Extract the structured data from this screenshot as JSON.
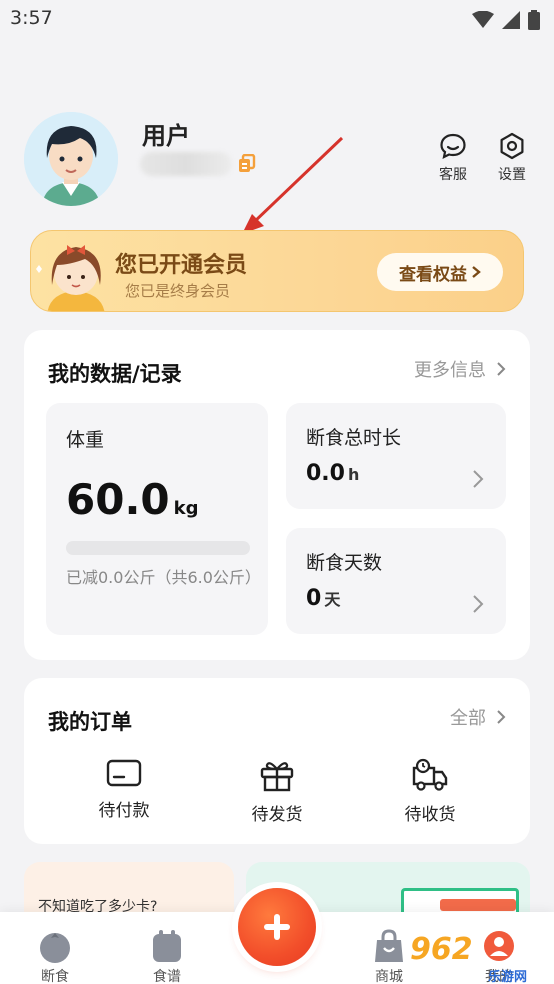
{
  "status_bar": {
    "time": "3:57"
  },
  "profile": {
    "username": "用户"
  },
  "top_actions": {
    "service_label": "客服",
    "settings_label": "设置"
  },
  "vip": {
    "title": "您已开通会员",
    "subtitle": "您已是终身会员",
    "button_label": "查看权益"
  },
  "data_section": {
    "title": "我的数据/记录",
    "more_label": "更多信息",
    "weight": {
      "label": "体重",
      "value": "60.0",
      "unit": "kg",
      "progress": 0.0,
      "note": "已减0.0公斤（共6.0公斤）"
    },
    "fasting_total": {
      "label": "断食总时长",
      "value": "0.0",
      "unit": "h"
    },
    "fasting_days": {
      "label": "断食天数",
      "value": "0",
      "unit": "天"
    }
  },
  "orders": {
    "title": "我的订单",
    "all_label": "全部",
    "items": [
      {
        "label": "待付款",
        "icon": "card-icon"
      },
      {
        "label": "待发货",
        "icon": "gift-icon"
      },
      {
        "label": "待收货",
        "icon": "delivery-truck-icon"
      }
    ]
  },
  "promo": {
    "left_text": "不知道吃了多少卡?"
  },
  "tabbar": {
    "items": [
      {
        "label": "断食",
        "icon": "tomato-icon"
      },
      {
        "label": "食谱",
        "icon": "recipe-book-icon"
      },
      {
        "label": "商城",
        "icon": "shopping-bag-icon"
      },
      {
        "label": "我的",
        "icon": "profile-icon"
      }
    ],
    "fab_icon": "plus-icon"
  },
  "watermark": {
    "text": "962",
    "sub": "乐游网"
  },
  "colors": {
    "accent": "#f24e2a",
    "vip_bg": "#fcd796",
    "vip_text": "#7a4a16",
    "page_bg": "#f3f3f5"
  }
}
